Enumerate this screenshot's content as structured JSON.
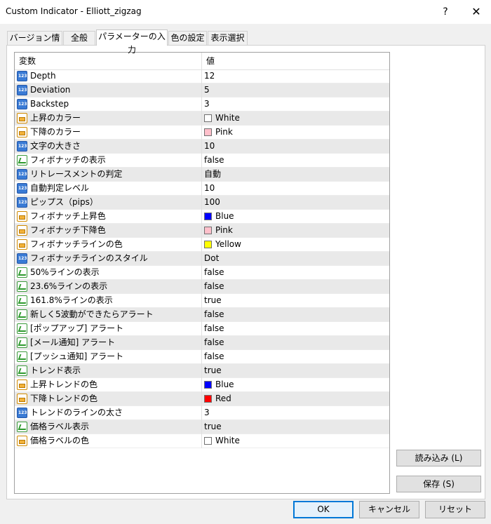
{
  "window": {
    "title": "Custom Indicator - Elliott_zigzag",
    "help": "?",
    "close": "✕"
  },
  "tabs": [
    "バージョン情報",
    "全般",
    "パラメーターの入力",
    "色の設定",
    "表示選択"
  ],
  "table": {
    "col_variable": "変数",
    "col_value": "値",
    "rows": [
      {
        "type": "num",
        "name": "Depth",
        "value": "12"
      },
      {
        "type": "num",
        "name": "Deviation",
        "value": "5"
      },
      {
        "type": "num",
        "name": "Backstep",
        "value": "3"
      },
      {
        "type": "color",
        "name": "上昇のカラー",
        "value": "White",
        "swatch": "#ffffff"
      },
      {
        "type": "color",
        "name": "下降のカラー",
        "value": "Pink",
        "swatch": "#ffc0cb"
      },
      {
        "type": "num",
        "name": "文字の大きさ",
        "value": "10"
      },
      {
        "type": "bool",
        "name": "フィボナッチの表示",
        "value": "false"
      },
      {
        "type": "num",
        "name": "リトレースメントの判定",
        "value": "自動"
      },
      {
        "type": "num",
        "name": "自動判定レベル",
        "value": "10"
      },
      {
        "type": "num",
        "name": "ピップス（pips）",
        "value": "100"
      },
      {
        "type": "color",
        "name": "フィボナッチ上昇色",
        "value": "Blue",
        "swatch": "#0000ff"
      },
      {
        "type": "color",
        "name": "フィボナッチ下降色",
        "value": "Pink",
        "swatch": "#ffc0cb"
      },
      {
        "type": "color",
        "name": "フィボナッチラインの色",
        "value": "Yellow",
        "swatch": "#ffff00"
      },
      {
        "type": "num",
        "name": "フィボナッチラインのスタイル",
        "value": "Dot"
      },
      {
        "type": "bool",
        "name": "50%ラインの表示",
        "value": "false"
      },
      {
        "type": "bool",
        "name": "23.6%ラインの表示",
        "value": "false"
      },
      {
        "type": "bool",
        "name": "161.8%ラインの表示",
        "value": "true"
      },
      {
        "type": "bool",
        "name": "新しく5波動ができたらアラート",
        "value": "false"
      },
      {
        "type": "bool",
        "name": "[ポップアップ] アラート",
        "value": "false"
      },
      {
        "type": "bool",
        "name": "[メール通知] アラート",
        "value": "false"
      },
      {
        "type": "bool",
        "name": "[プッシュ通知] アラート",
        "value": "false"
      },
      {
        "type": "bool",
        "name": "トレンド表示",
        "value": "true"
      },
      {
        "type": "color",
        "name": "上昇トレンドの色",
        "value": "Blue",
        "swatch": "#0000ff"
      },
      {
        "type": "color",
        "name": "下降トレンドの色",
        "value": "Red",
        "swatch": "#ff0000"
      },
      {
        "type": "num",
        "name": "トレンドのラインの太さ",
        "value": "3"
      },
      {
        "type": "bool",
        "name": "価格ラベル表示",
        "value": "true"
      },
      {
        "type": "color",
        "name": "価格ラベルの色",
        "value": "White",
        "swatch": "#ffffff"
      }
    ]
  },
  "buttons": {
    "load": "読み込み (L)",
    "save": "保存 (S)",
    "ok": "OK",
    "cancel": "キャンセル",
    "reset": "リセット"
  }
}
